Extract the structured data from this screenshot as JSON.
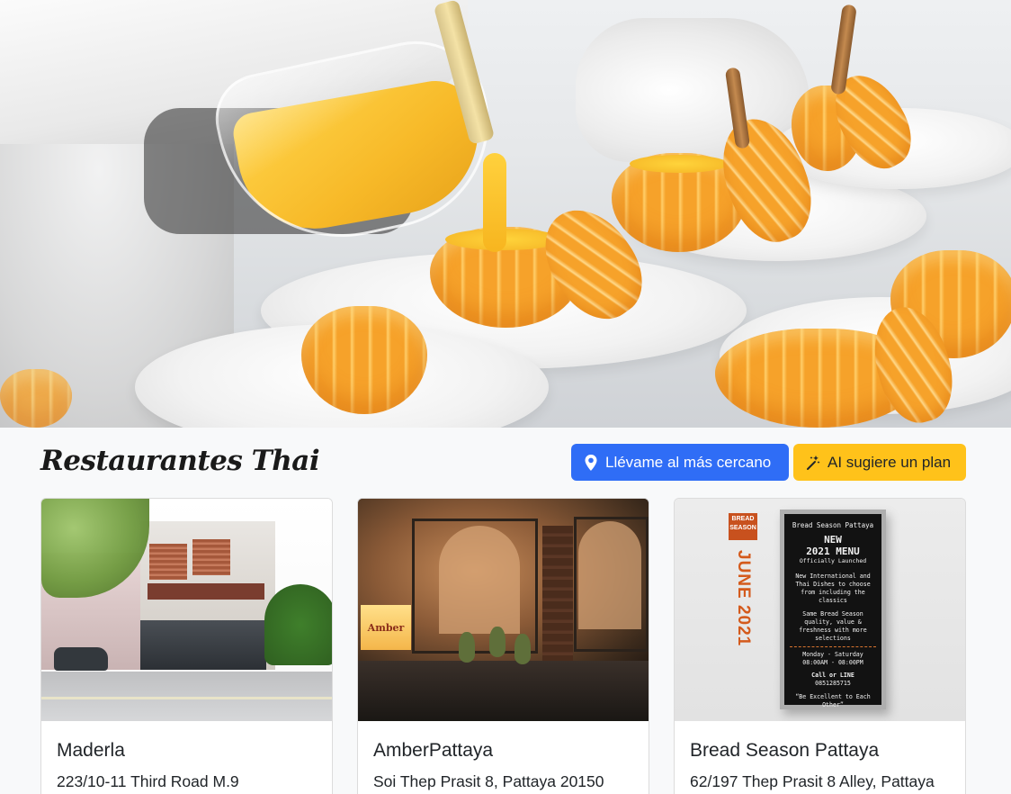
{
  "header": {
    "title": "Restaurantes Thai",
    "nearest_button": "Llévame al más cercano",
    "ai_button": "AI sugiere un plan"
  },
  "icons": {
    "nearest_button": "map-pin-icon",
    "ai_button": "magic-wand-icon"
  },
  "colors": {
    "primary": "#2f6df6",
    "warning": "#ffc21a",
    "background": "#f8f9fa"
  },
  "restaurants": [
    {
      "name": "Maderla",
      "address": "223/10-11 Third Road M.9"
    },
    {
      "name": "AmberPattaya",
      "address": "Soi Thep Prasit 8, Pattaya 20150",
      "sign_text": "Amber"
    },
    {
      "name": "Bread Season Pattaya",
      "address": "62/197 Thep Prasit 8 Alley, Pattaya",
      "logo_text": "BREAD SEASON",
      "banner_text": "JUNE 2021",
      "poster": {
        "line1": "Bread Season Pattaya",
        "line2": "NEW",
        "line3": "2021 MENU",
        "line4": "Officially Launched",
        "line5": "New International and Thai Dishes to choose from including the classics",
        "line6": "Same Bread Season quality, value & freshness with more selections",
        "line7": "Monday - Saturday",
        "line8": "08:00AM - 08:00PM",
        "line9": "Call or LINE",
        "line10": "0851285715",
        "line11": "“Be Excellent to Each Other”"
      }
    }
  ]
}
